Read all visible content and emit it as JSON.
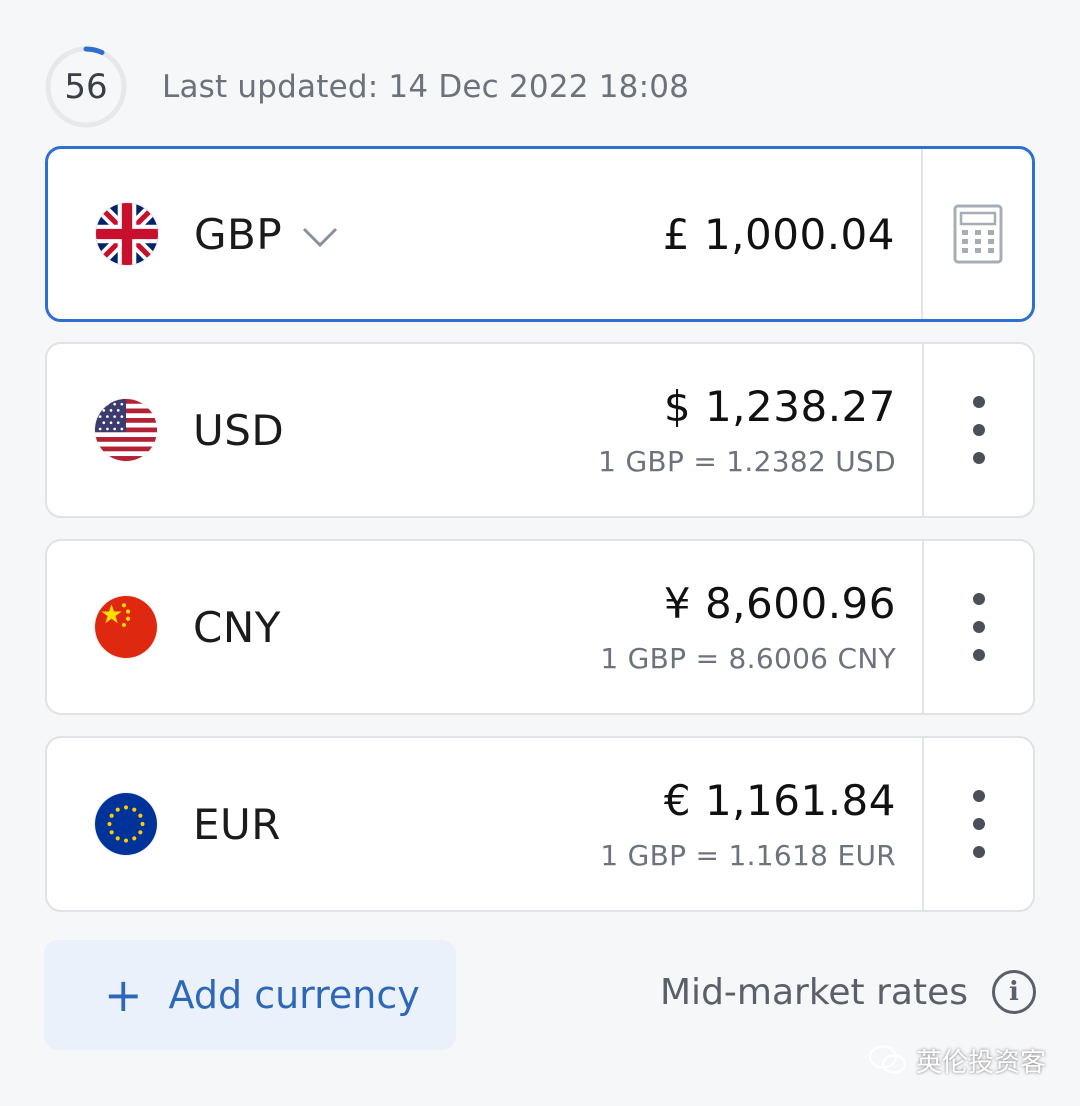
{
  "header": {
    "timer_value": "56",
    "last_updated": "Last updated: 14 Dec 2022 18:08"
  },
  "base": {
    "code": "GBP",
    "amount": "£ 1,000.04",
    "flag_icon": "uk-flag-icon",
    "side_icon": "calculator-icon"
  },
  "rows": [
    {
      "code": "USD",
      "amount": "$ 1,238.27",
      "rate": "1 GBP = 1.2382 USD",
      "flag_icon": "us-flag-icon"
    },
    {
      "code": "CNY",
      "amount": "¥ 8,600.96",
      "rate": "1 GBP = 8.6006 CNY",
      "flag_icon": "cn-flag-icon"
    },
    {
      "code": "EUR",
      "amount": "€ 1,161.84",
      "rate": "1 GBP = 1.1618 EUR",
      "flag_icon": "eu-flag-icon"
    }
  ],
  "footer": {
    "add_label": "Add currency",
    "mid_label": "Mid-market rates",
    "watermark": "英伦投资客"
  },
  "colors": {
    "accent": "#2f6fcf",
    "button_bg": "#eaf1fb",
    "button_text": "#2f67b8"
  }
}
